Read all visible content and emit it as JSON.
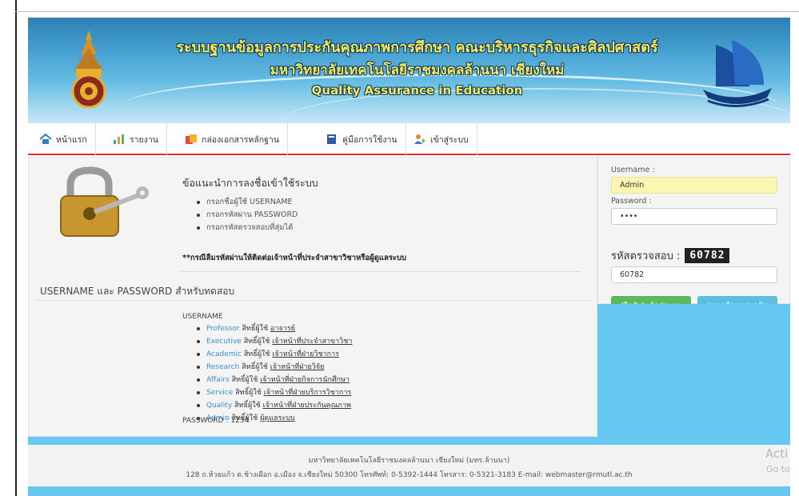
{
  "header": {
    "title_line1": "ระบบฐานข้อมูลการประกันคุณภาพการศึกษา คณะบริหารธุรกิจและศิลปศาสตร์",
    "title_line2": "มหาวิทยาลัยเทคโนโลยีราชมงคลล้านนา เชียงใหม่",
    "title_line3": "Quality Assurance in Education"
  },
  "nav": {
    "items": [
      {
        "label": "หน้าแรก",
        "icon": "home-icon"
      },
      {
        "label": "รายงาน",
        "icon": "report-icon"
      },
      {
        "label": "กล่องเอกสารหลักฐาน",
        "icon": "document-box-icon"
      },
      {
        "label": "คู่มือการใช้งาน",
        "icon": "manual-icon"
      },
      {
        "label": "เข้าสู่ระบบ",
        "icon": "login-user-icon"
      }
    ]
  },
  "guide": {
    "heading": "ข้อแนะนำการลงชื่อเข้าใช้ระบบ",
    "steps": [
      "กรอกชื่อผู้ใช้ USERNAME",
      "กรอกรหัสผ่าน PASSWORD",
      "กรอกรหัสตรวจสอบที่สุ่มได้"
    ],
    "warning": "**กรณีลืมรหัสผ่านให้ติดต่อเจ้าหน้าที่ประจำสาขาวิชาหรือผู้ดูแลระบบ"
  },
  "test_accounts": {
    "title": "USERNAME และ PASSWORD สำหรับทดสอบ",
    "username_label": "USERNAME",
    "perm_word": "สิทธิ์ผู้ใช้",
    "accounts": [
      {
        "role": "Professor",
        "target": "อาจารย์"
      },
      {
        "role": "Executive",
        "target": "เจ้าหน้าที่ประจำสาขาวิชา"
      },
      {
        "role": "Academic",
        "target": "เจ้าหน้าที่ฝ่ายวิชาการ"
      },
      {
        "role": "Research",
        "target": "เจ้าหน้าที่ฝ่ายวิจัย"
      },
      {
        "role": "Affairs",
        "target": "เจ้าหน้าที่ฝ่ายกิจการนักศึกษา"
      },
      {
        "role": "Service",
        "target": "เจ้าหน้าที่ฝ่ายบริการวิชาการ"
      },
      {
        "role": "Quality",
        "target": "เจ้าหน้าที่ฝ่ายประกันคุณภาพ"
      },
      {
        "role": "Admin",
        "target": "ผู้ดูแลระบบ"
      }
    ],
    "password_line": "PASSWORD : 1234"
  },
  "login": {
    "username_label": "Username :",
    "username_value": "Admin",
    "password_label": "Password :",
    "password_value": "••••",
    "captcha_label": "รหัสตรวจสอบ :",
    "captcha_code": "60782",
    "captcha_value": "60782",
    "submit_label": "[ยืนยัน] เข้าสู่ระบบ",
    "register_label": "กรอกข้อมูลสมาชิก"
  },
  "footer": {
    "line1": "มหาวิทยาลัยเทคโนโลยีราชมงคลล้านนา เชียงใหม่ (มทร.ล้านนา)",
    "line2": "128 ถ.ห้วยแก้ว ต.ช้างเผือก อ.เมือง จ.เชียงใหม่ 50300 โทรศัพท์: 0-5392-1444 โทรสาร: 0-5321-3183 E-mail: webmaster@rmutl.ac.th"
  },
  "os_overlay": {
    "line1": "Acti",
    "line2": "Go to"
  },
  "colors": {
    "nav_underline": "#d9302f",
    "accent_blue": "#66c8f0",
    "submit_green": "#5cb85c",
    "register_cyan": "#5bc0de"
  }
}
